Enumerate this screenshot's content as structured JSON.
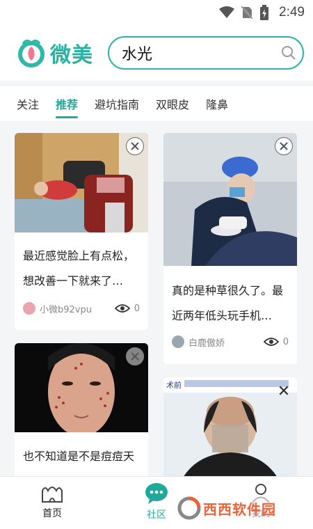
{
  "status_bar": {
    "time": "2:49",
    "icons": [
      "wifi-icon",
      "no-sim-icon",
      "battery-charging-icon"
    ]
  },
  "header": {
    "logo_text": "微美",
    "search_value": "水光",
    "search_icon": "search-icon"
  },
  "tabs": [
    {
      "label": "关注",
      "active": false
    },
    {
      "label": "推荐",
      "active": true
    },
    {
      "label": "避坑指南",
      "active": false
    },
    {
      "label": "双眼皮",
      "active": false
    },
    {
      "label": "隆鼻",
      "active": false
    }
  ],
  "feed": {
    "cards": [
      {
        "text_line1": "最近感觉脸上有点松，",
        "text_line2": "想改善一下就来了…",
        "author": "小微b92vpu",
        "views": "0"
      },
      {
        "text_line1": "真的是种草很久了。最",
        "text_line2": "近两年低头玩手机…",
        "author": "白鹿傲娇",
        "views": "0"
      },
      {
        "text_line1": "也不知道是不是痘痘天",
        "text_line2": ""
      },
      {
        "banner_text": "术前"
      }
    ]
  },
  "bottom_nav": [
    {
      "label": "首页",
      "icon": "home-icon",
      "active": false
    },
    {
      "label": "社区",
      "icon": "chat-bubble-icon",
      "active": true
    },
    {
      "label": "我的",
      "icon": "person-icon",
      "active": false
    }
  ],
  "watermark": {
    "text": "西西软件园"
  },
  "colors": {
    "accent": "#1fa89b",
    "brand": "#27b3a4"
  }
}
